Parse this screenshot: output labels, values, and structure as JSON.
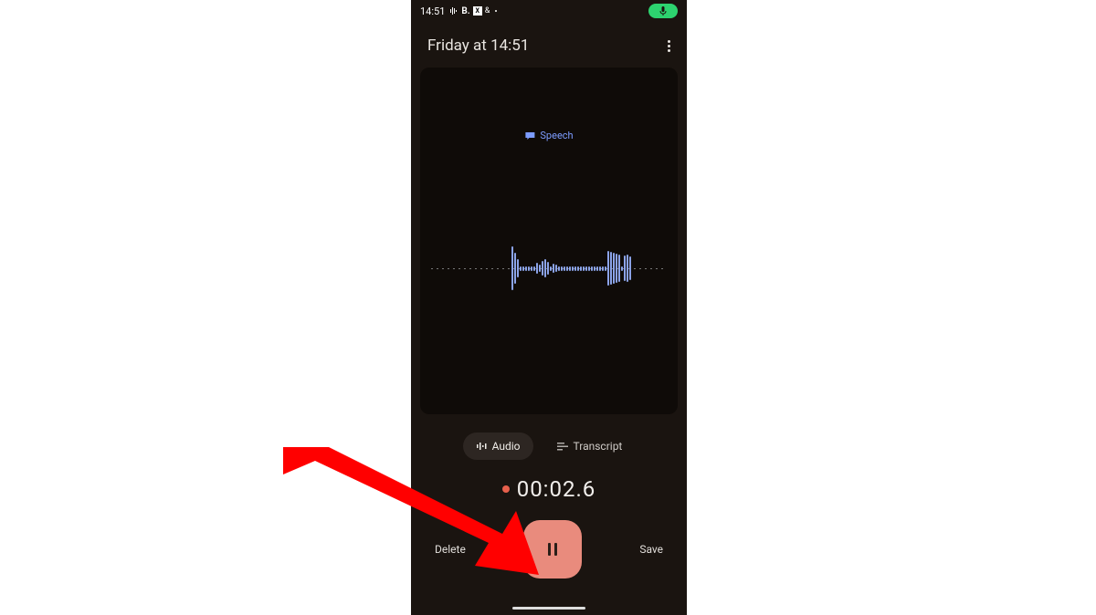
{
  "status": {
    "time": "14:51",
    "icons": {
      "b": "B.",
      "x": "X"
    }
  },
  "header": {
    "title": "Friday at 14:51"
  },
  "speech": {
    "label": "Speech"
  },
  "tabs": {
    "audio": "Audio",
    "transcript": "Transcript"
  },
  "timer": {
    "value": "00:02.6"
  },
  "controls": {
    "delete": "Delete",
    "save": "Save"
  },
  "colors": {
    "bg_dark": "#1a1410",
    "wave_bg": "#0f0b08",
    "accent": "#e98b7d",
    "speech_blue": "#7c9cff",
    "mic_green": "#2dd36f",
    "rec_red": "#e8604c",
    "arrow_red": "#ff0000"
  },
  "waveform_heights": [
    48,
    34,
    20,
    5,
    5,
    5,
    5,
    5,
    5,
    12,
    8,
    16,
    20,
    14,
    5,
    10,
    8,
    5,
    5,
    5,
    5,
    5,
    5,
    5,
    5,
    5,
    5,
    5,
    5,
    5,
    5,
    5,
    5,
    5,
    5,
    38,
    36,
    34,
    32,
    30,
    5,
    28,
    30,
    26
  ]
}
